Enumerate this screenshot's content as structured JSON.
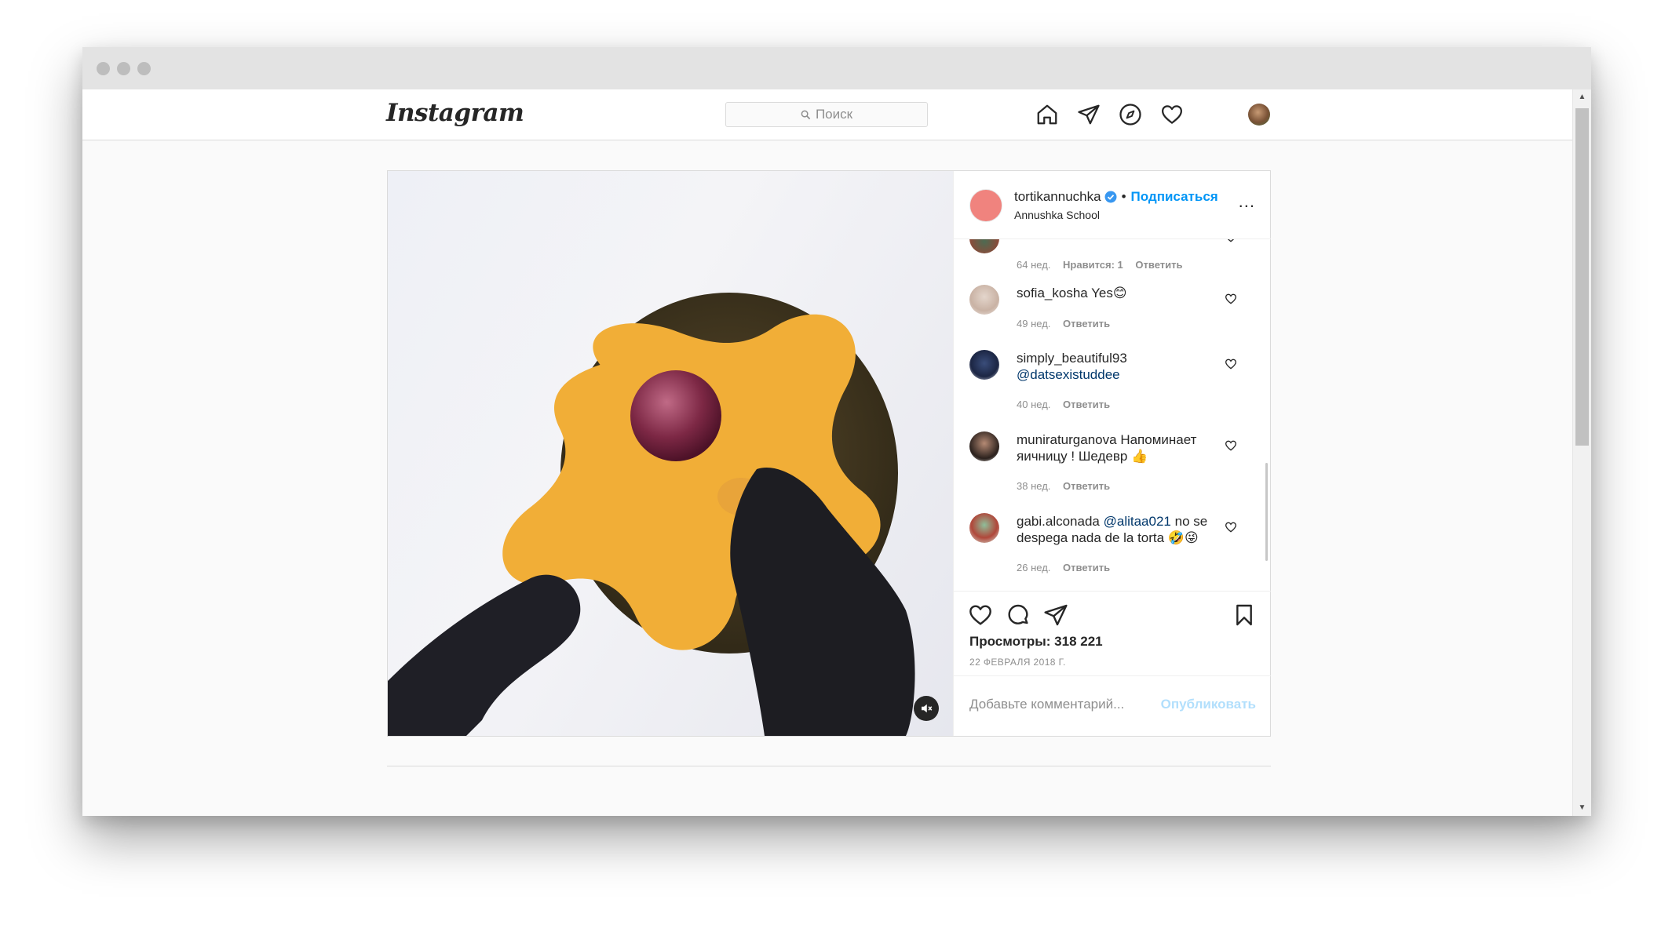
{
  "nav": {
    "logo": "Instagram",
    "search_placeholder": "Поиск"
  },
  "post": {
    "author": {
      "username": "tortikannuchka",
      "follow_label": "Подписаться",
      "bullet": "•",
      "location": "Annushka School"
    },
    "more_label": "...",
    "comments": [
      {
        "username": "",
        "text": "",
        "time": "64 нед.",
        "likes": "Нравится: 1",
        "reply": "Ответить"
      },
      {
        "username": "sofia_kosha",
        "text": "Yes😊",
        "time": "49 нед.",
        "likes": "",
        "reply": "Ответить"
      },
      {
        "username": "simply_beautiful93",
        "mention": "@datsexistuddee",
        "text": "",
        "time": "40 нед.",
        "likes": "",
        "reply": "Ответить"
      },
      {
        "username": "muniraturganova",
        "text": "Напоминает яичницу ! Шедевр 👍",
        "time": "38 нед.",
        "likes": "",
        "reply": "Ответить"
      },
      {
        "username": "gabi.alconada",
        "mention": "@alitaa021",
        "text": "no se despega nada de la torta 🤣😜",
        "time": "26 нед.",
        "likes": "",
        "reply": "Ответить"
      }
    ],
    "views_label": "Просмотры:",
    "views_count": "318 221",
    "date": "22 ФЕВРАЛЯ 2018 Г.",
    "add_comment_placeholder": "Добавьте комментарий...",
    "publish_label": "Опубликовать"
  },
  "icons": {
    "nav": [
      "home-icon",
      "direct-icon",
      "explore-icon",
      "activity-heart-icon",
      "profile-avatar"
    ],
    "actions": [
      "like-heart-icon",
      "comment-icon",
      "share-icon",
      "bookmark-icon"
    ],
    "media": [
      "mute-icon"
    ]
  },
  "colors": {
    "accent": "#0095f6",
    "publish_disabled": "#b2dffc",
    "mention": "#00376b",
    "author_avatar": "#f0837e"
  }
}
